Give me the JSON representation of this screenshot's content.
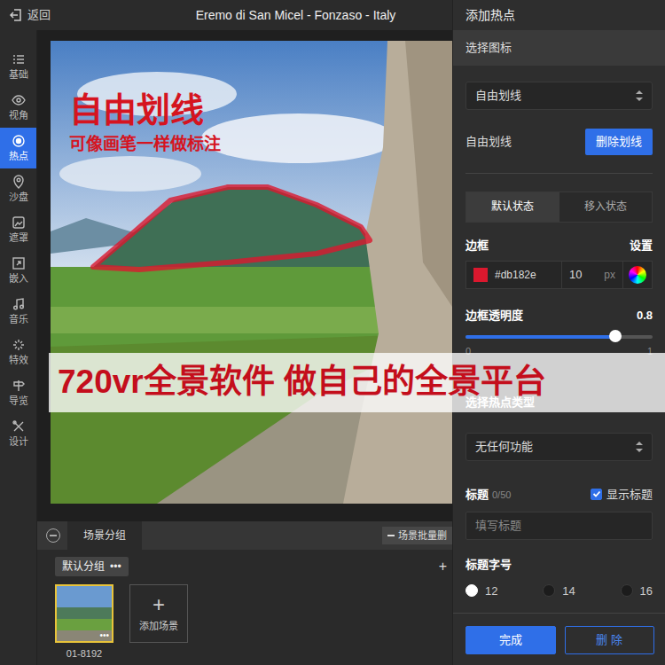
{
  "window": {
    "title": "Eremo di San Micel - Fonzaso - Italy",
    "back": "返回"
  },
  "sidebar": {
    "items": [
      {
        "label": "基础",
        "selected": false
      },
      {
        "label": "视角",
        "selected": false
      },
      {
        "label": "热点",
        "selected": true
      },
      {
        "label": "沙盘",
        "selected": false
      },
      {
        "label": "遮罩",
        "selected": false
      },
      {
        "label": "嵌入",
        "selected": false
      },
      {
        "label": "音乐",
        "selected": false
      },
      {
        "label": "特效",
        "selected": false
      },
      {
        "label": "导览",
        "selected": false
      },
      {
        "label": "设计",
        "selected": false
      }
    ]
  },
  "annotation": {
    "title": "自由划线",
    "subtitle": "可像画笔一样做标注"
  },
  "banner": {
    "text": "720vr全景软件 做自己的全景平台"
  },
  "scenes": {
    "tab": "场景分组",
    "batch_delete": "场景批量删",
    "group": "默认分组",
    "group_menu": "•••",
    "add_group": "+",
    "items": [
      {
        "label": "01-8192",
        "menu": "•••",
        "selected": true
      }
    ],
    "add_icon": "+",
    "add_label": "添加场景"
  },
  "panel": {
    "title": "添加热点",
    "section": "选择图标",
    "icon_select": "自由划线",
    "draw": {
      "label": "自由划线",
      "button": "删除划线"
    },
    "state_tabs": [
      {
        "label": "默认状态",
        "selected": true
      },
      {
        "label": "移入状态",
        "selected": false
      }
    ],
    "border": {
      "label": "边框",
      "settings": "设置",
      "color": "#db182e",
      "hex": "#db182e",
      "width": "10",
      "unit": "px"
    },
    "opacity": {
      "label": "边框透明度",
      "reading": "0.8",
      "level": 0.8,
      "min": "0",
      "max": "1"
    },
    "type": {
      "label": "选择热点类型",
      "value": "无任何功能"
    },
    "title_field": {
      "label": "标题",
      "count": "0/50",
      "show": {
        "label": "显示标题",
        "checked": true
      },
      "placeholder": "填写标题"
    },
    "font_size": {
      "label": "标题字号",
      "options": [
        {
          "label": "12",
          "selected": true
        },
        {
          "label": "14",
          "selected": false
        },
        {
          "label": "16",
          "selected": false
        }
      ]
    },
    "buttons": [
      {
        "label": "完成",
        "kind": "primary"
      },
      {
        "label": "删 除",
        "kind": "outline"
      }
    ]
  }
}
